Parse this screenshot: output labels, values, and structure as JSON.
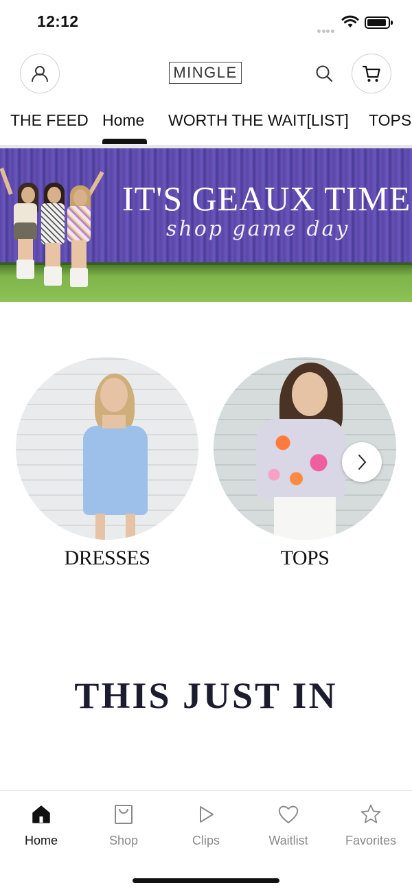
{
  "status_bar": {
    "time": "12:12"
  },
  "header": {
    "logo": "MINGLE"
  },
  "category_nav": {
    "tabs": [
      {
        "label": "THE FEED"
      },
      {
        "label": "Home",
        "active": true
      },
      {
        "label": "WORTH THE WAIT[LIST]"
      },
      {
        "label": "TOPS"
      }
    ]
  },
  "hero_banner": {
    "title": "IT'S GEAUX TIME",
    "subtitle": "shop game day"
  },
  "categories": [
    {
      "label": "DRESSES"
    },
    {
      "label": "TOPS"
    }
  ],
  "section": {
    "heading": "THIS JUST IN"
  },
  "tab_bar": {
    "items": [
      {
        "label": "Home",
        "icon": "home-icon",
        "active": true
      },
      {
        "label": "Shop",
        "icon": "shop-bag-icon"
      },
      {
        "label": "Clips",
        "icon": "play-icon"
      },
      {
        "label": "Waitlist",
        "icon": "heart-icon"
      },
      {
        "label": "Favorites",
        "icon": "star-icon"
      }
    ]
  },
  "colors": {
    "hero_purple": "#5a47a8",
    "heading_navy": "#1b1d2e",
    "active_tab": "#111111",
    "inactive_tab": "#8a8a8a"
  }
}
